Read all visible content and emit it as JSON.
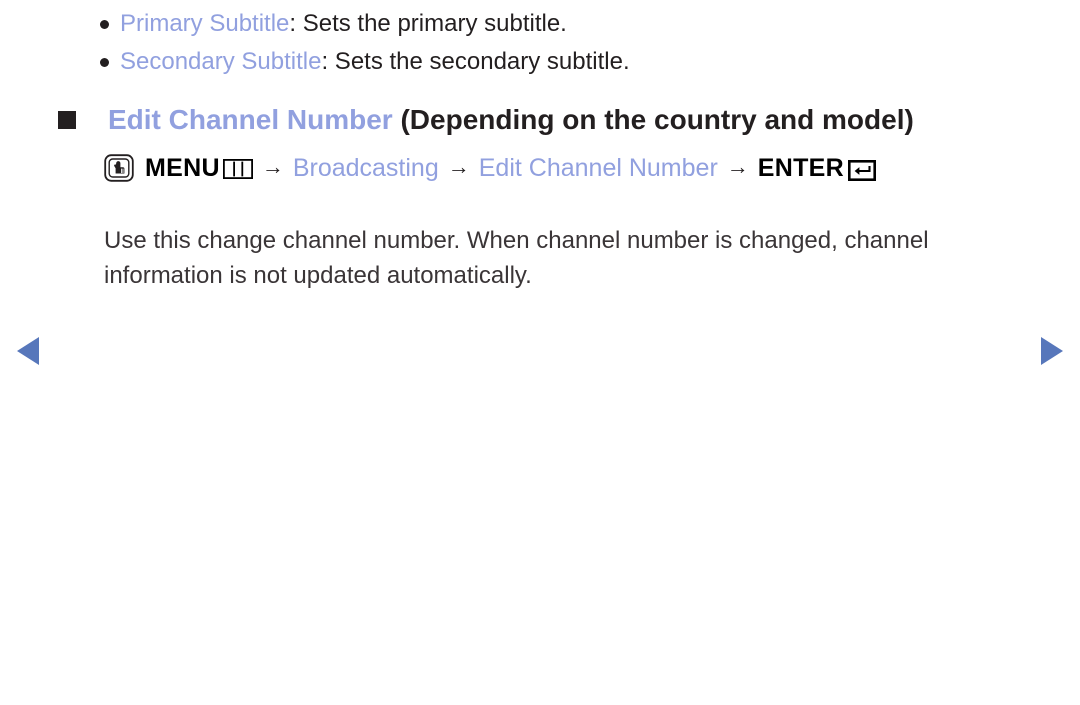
{
  "colors": {
    "link_blue": "#91a0df",
    "nav_arrow_blue": "#5777bb",
    "body_text": "#3a3537",
    "marker_black": "#231f20",
    "background": "#ffffff"
  },
  "bullets": [
    {
      "marker": "bullet-dot",
      "term": "Primary Subtitle",
      "description": ": Sets the primary subtitle."
    },
    {
      "marker": "bullet-dot",
      "term": "Secondary Subtitle",
      "description": ": Sets the secondary subtitle."
    }
  ],
  "section": {
    "marker": "bullet-square",
    "title": "Edit Channel Number",
    "title_note": " (Depending on the country and model)",
    "menu_path": {
      "prefix_icon": "menu-press-button-icon",
      "menu_label": "MENU",
      "menu_bars_icon": "menu-bars-icon",
      "arrow_1": "→",
      "step_1": "Broadcasting",
      "arrow_2": "→",
      "step_2": "Edit Channel Number",
      "arrow_3": "→",
      "enter_label": "ENTER",
      "enter_icon": "enter-return-key-icon"
    },
    "body": "Use this change channel number. When channel number is changed, channel information is not updated automatically."
  },
  "navigation": {
    "prev_label": "previous-page",
    "prev_icon": "triangle-left-icon",
    "next_label": "next-page",
    "next_icon": "triangle-right-icon"
  }
}
